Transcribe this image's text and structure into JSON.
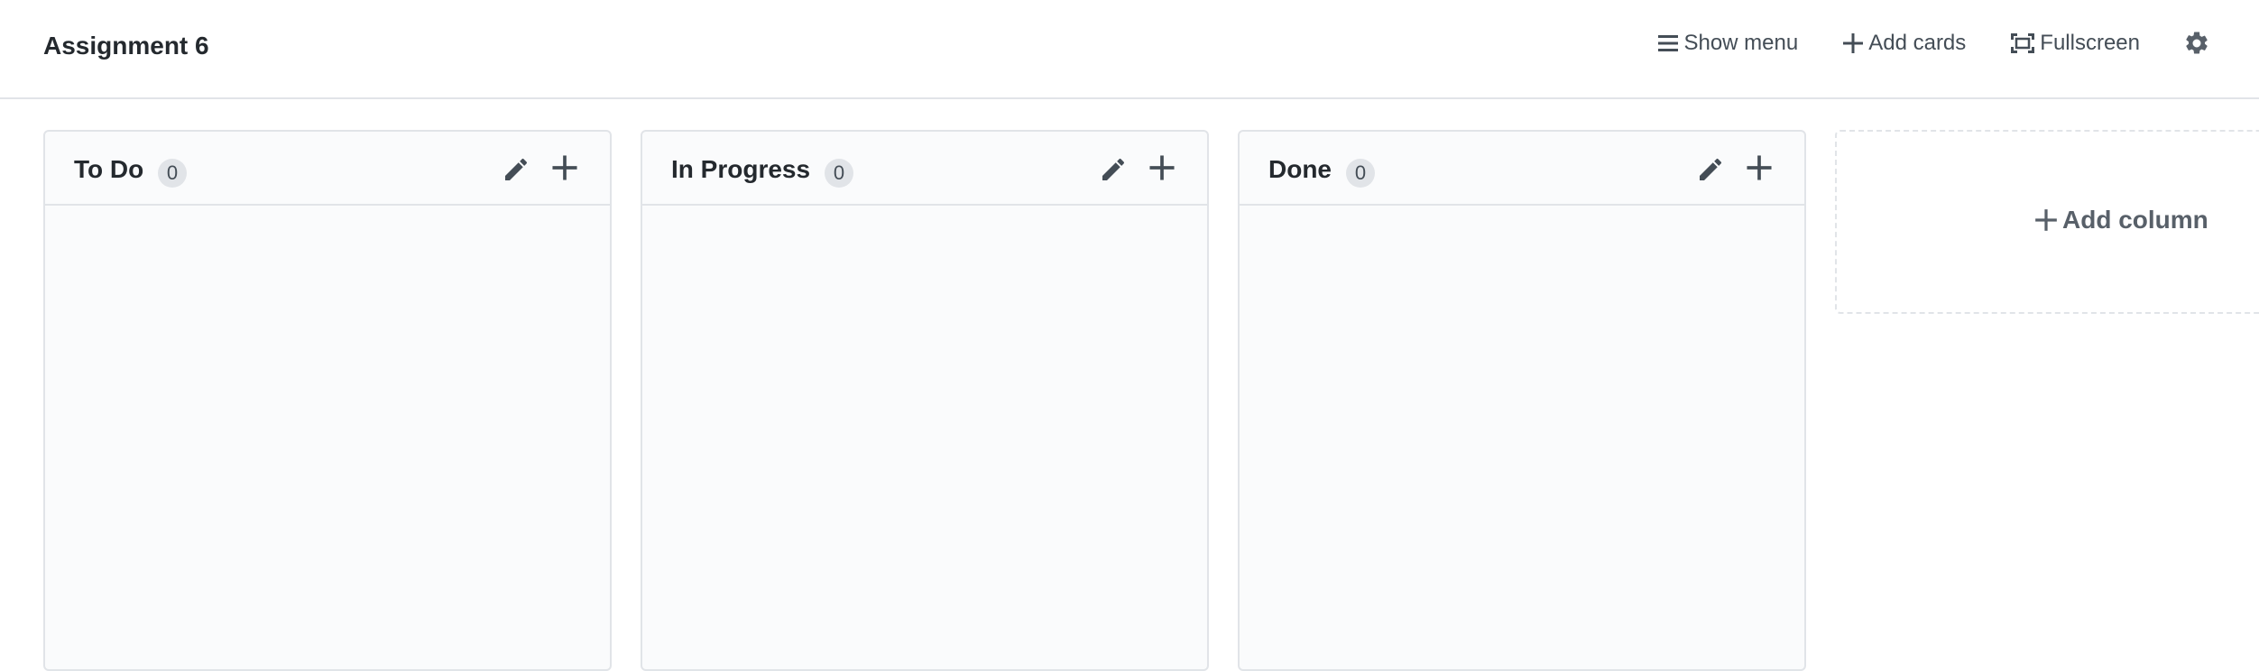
{
  "header": {
    "title": "Assignment 6",
    "show_menu_label": "Show menu",
    "add_cards_label": "Add cards",
    "fullscreen_label": "Fullscreen",
    "menu_icon": "hamburger-icon",
    "plus_icon": "plus-icon",
    "fullscreen_icon": "fullscreen-icon",
    "settings_icon": "gear-icon"
  },
  "columns": [
    {
      "name": "To Do",
      "count": "0"
    },
    {
      "name": "In Progress",
      "count": "0"
    },
    {
      "name": "Done",
      "count": "0"
    }
  ],
  "add_column": {
    "label": "Add column"
  },
  "colors": {
    "border": "#e1e4e8",
    "column_bg": "#fafbfc",
    "text": "#24292e",
    "muted": "#586069",
    "badge_bg": "#e1e4e8"
  }
}
